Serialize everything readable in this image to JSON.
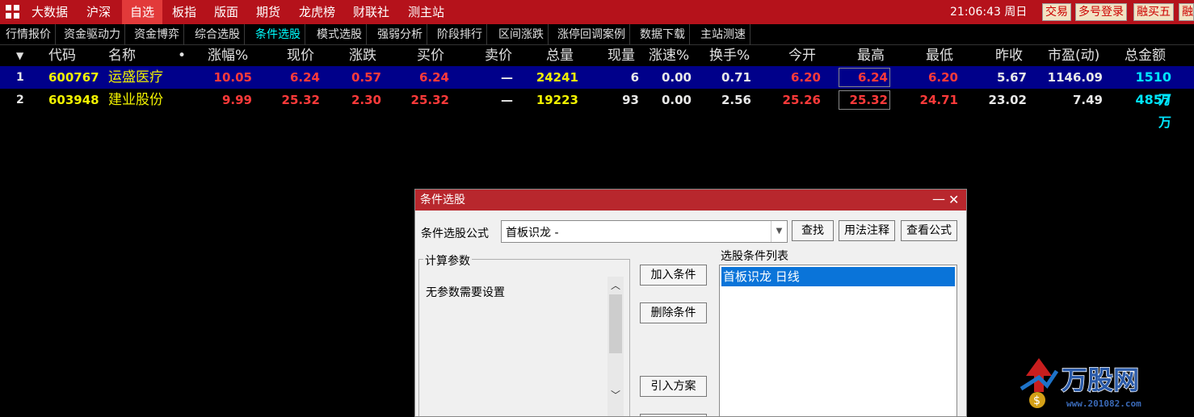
{
  "topbar": {
    "menu": [
      "大数据",
      "沪深",
      "自选",
      "板指",
      "版面",
      "期货",
      "龙虎榜",
      "财联社",
      "测主站"
    ],
    "active_index": 2,
    "clock": "21:06:43 周日",
    "buttons": [
      "交易",
      "多号登录",
      "融买五",
      "融"
    ]
  },
  "tabs": {
    "items": [
      "行情报价",
      "资金驱动力",
      "资金博弈",
      "综合选股",
      "条件选股",
      "模式选股",
      "强弱分析",
      "阶段排行",
      "区间涨跌",
      "涨停回调案例",
      "数据下载",
      "主站测速"
    ],
    "active_index": 4
  },
  "table": {
    "columns": [
      "代码",
      "名称",
      "•",
      "涨幅%",
      "现价",
      "涨跌",
      "买价",
      "卖价",
      "总量",
      "现量",
      "涨速%",
      "换手%",
      "今开",
      "最高",
      "最低",
      "昨收",
      "市盈(动)",
      "总金额"
    ],
    "rows": [
      {
        "idx": "1",
        "code": "600767",
        "name": "运盛医疗",
        "chg_pct": "10.05",
        "price": "6.24",
        "chg": "0.57",
        "bid": "6.24",
        "ask": "—",
        "volume": "24241",
        "cur_vol": "6",
        "speed": "0.00",
        "turnover": "0.71",
        "open": "6.20",
        "high": "6.24",
        "low": "6.20",
        "prev_close": "5.67",
        "pe": "1146.09",
        "amount": "1510万"
      },
      {
        "idx": "2",
        "code": "603948",
        "name": "建业股份",
        "chg_pct": "9.99",
        "price": "25.32",
        "chg": "2.30",
        "bid": "25.32",
        "ask": "—",
        "volume": "19223",
        "cur_vol": "93",
        "speed": "0.00",
        "turnover": "2.56",
        "open": "25.26",
        "high": "25.32",
        "low": "24.71",
        "prev_close": "23.02",
        "pe": "7.49",
        "amount": "4857万"
      }
    ]
  },
  "dialog": {
    "title": "条件选股",
    "min_icon": "—",
    "close_icon": "✕",
    "formula_label": "条件选股公式",
    "formula_value": "首板识龙      -",
    "find_btn": "查找",
    "usage_btn": "用法注释",
    "view_btn": "查看公式",
    "params_legend": "计算参数",
    "params_text": "无参数需要设置",
    "add_btn": "加入条件",
    "del_btn": "删除条件",
    "import_btn": "引入方案",
    "list_label": "选股条件列表",
    "list_item": "首板识龙  日线"
  },
  "watermark": {
    "brand": "万股网",
    "url": "www.201082.com"
  },
  "colors": {
    "topbar": "#b5121b",
    "dialog_title": "#b8272d",
    "selected_row": "#00008a",
    "list_selected": "#0a74d9"
  }
}
